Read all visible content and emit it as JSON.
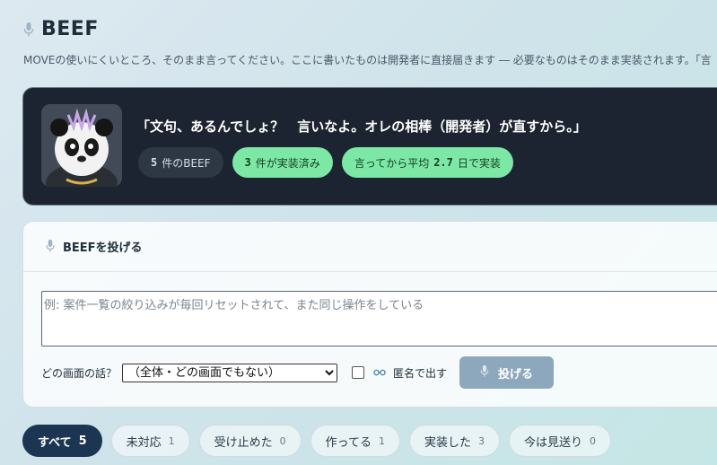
{
  "header": {
    "title": "BEEF",
    "subtitle": "MOVEの使いにくいところ、そのまま言ってください。ここに書いたものは開発者に直接届きます ― 必要なものはそのまま実装されます。「言"
  },
  "hero": {
    "quote": "「文句、あるんでしょ？　言いなよ。オレの相棒（開発者）が直すから。」",
    "stats": {
      "beef_count": "5",
      "beef_label": "件のBEEF",
      "implemented_count": "3",
      "implemented_label": "件が実装済み",
      "avg_prefix": "言ってから平均",
      "avg_days": "2.7",
      "avg_suffix": "日で実装"
    }
  },
  "form": {
    "heading": "BEEFを投げる",
    "textarea_placeholder": "例: 案件一覧の絞り込みが毎回リセットされて、また同じ操作をしている",
    "screen_question": "どの画面の話？",
    "screen_select_value": "（全体・どの画面でもない）",
    "anonymous_label": "匿名で出す",
    "submit_label": "投げる"
  },
  "tabs": [
    {
      "label": "すべて",
      "count": "5"
    },
    {
      "label": "未対応",
      "count": "1"
    },
    {
      "label": "受け止めた",
      "count": "0"
    },
    {
      "label": "作ってる",
      "count": "1"
    },
    {
      "label": "実装した",
      "count": "3"
    },
    {
      "label": "今は見送り",
      "count": "0"
    }
  ],
  "colors": {
    "hero_bg": "#1b2430",
    "green_pill": "#7de8a5",
    "active_tab": "#1c3552",
    "submit_button": "#8da8bd"
  }
}
